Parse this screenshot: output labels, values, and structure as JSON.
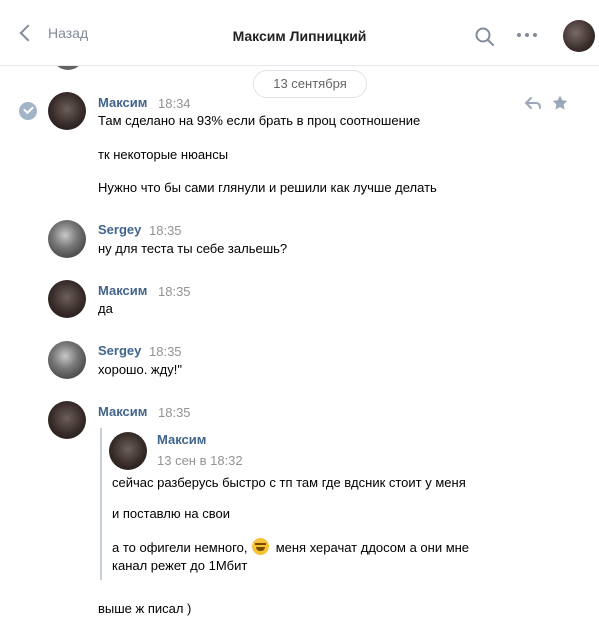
{
  "header": {
    "back_label": "Назад",
    "title": "Максим Липницкий",
    "icons": [
      "search-icon",
      "more-icon"
    ]
  },
  "date_separator": "13 сентября",
  "messages": [
    {
      "author": "Максим",
      "time": "18:34",
      "lines": [
        "Там сделано на 93% если брать в проц соотношение",
        "тк некоторые нюансы",
        "Нужно что бы сами глянули и решили как лучше делать"
      ]
    },
    {
      "author": "Sergey",
      "time": "18:35",
      "lines": [
        "ну для теста ты себе зальешь?"
      ]
    },
    {
      "author": "Максим",
      "time": "18:35",
      "lines": [
        "да"
      ]
    },
    {
      "author": "Sergey",
      "time": "18:35",
      "lines": [
        "хорошо. жду!\""
      ]
    },
    {
      "author": "Максим",
      "time": "18:35",
      "forwarded": {
        "author": "Максим",
        "date": "13 сен в 18:32",
        "lines": [
          "сейчас разберусь быстро с тп там где вдсник стоит у меня",
          "и поставлю на свои",
          "а то офигели немного,",
          "меня херачат ддосом а они мне",
          "канал режет до 1Мбит"
        ],
        "emoji": "laughing-emoji"
      },
      "lines": [
        "выше ж писал )"
      ]
    }
  ],
  "colors": {
    "name": "#42648b",
    "time": "#939393",
    "accent_icon": "#818c99",
    "divider": "#e7e8ec"
  }
}
